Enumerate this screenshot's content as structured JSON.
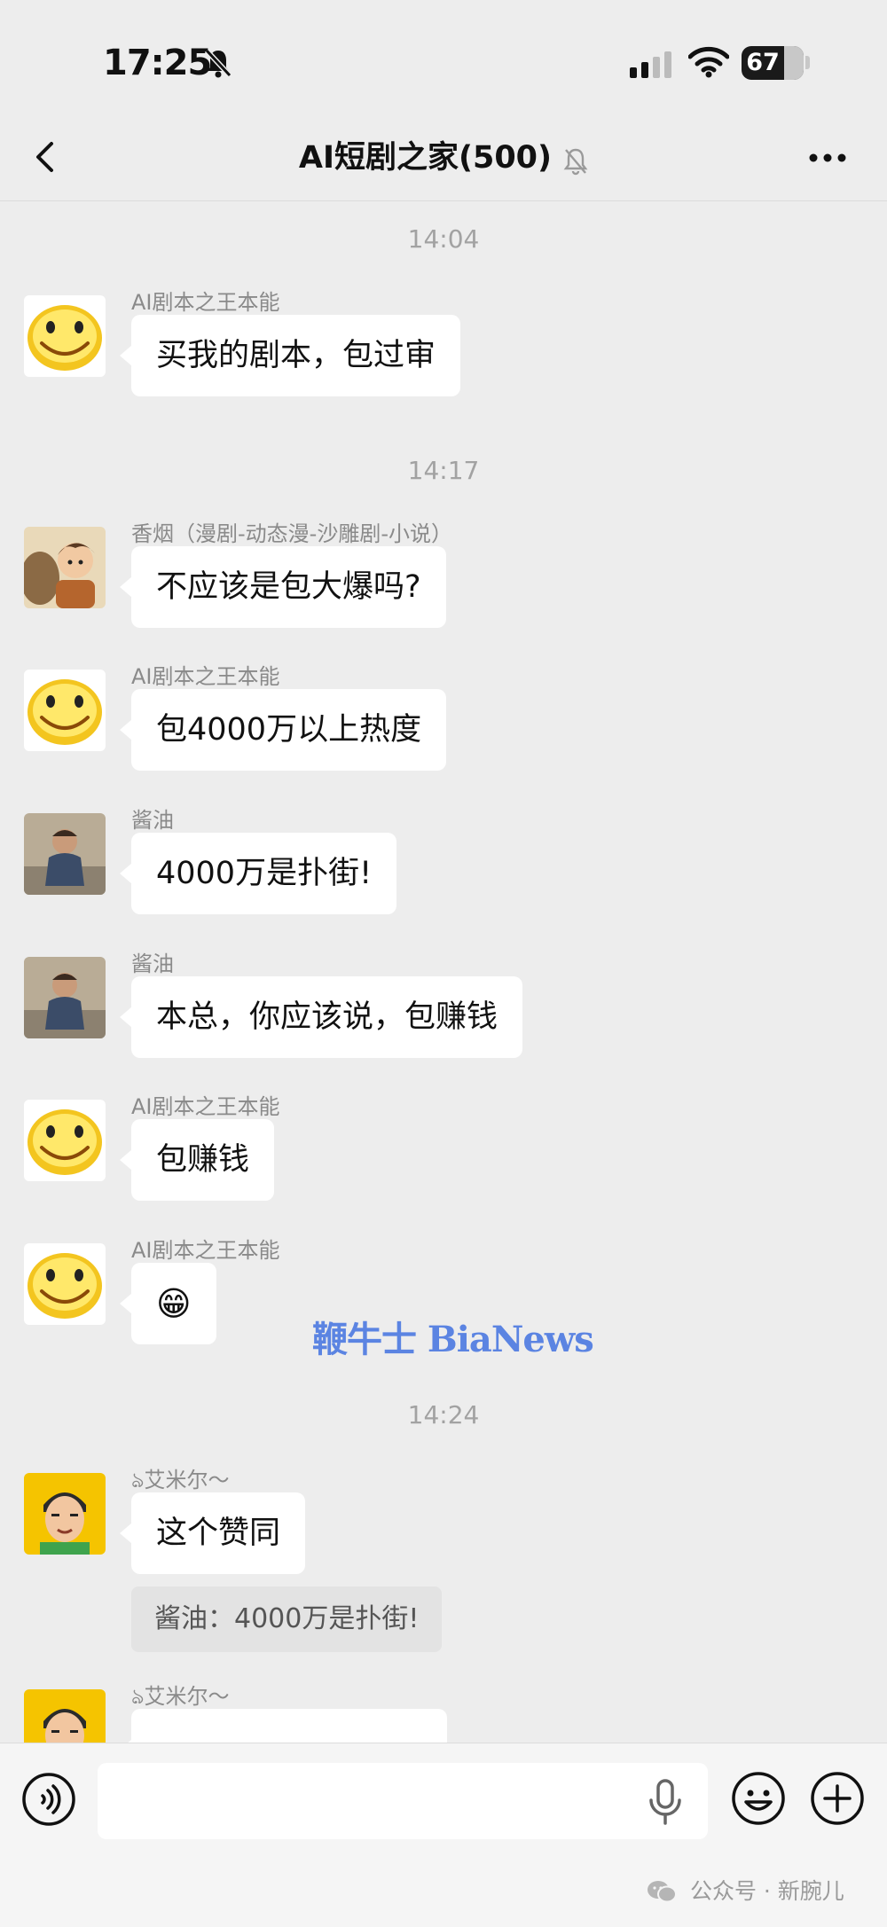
{
  "status_bar": {
    "time": "17:25",
    "battery": "67"
  },
  "header": {
    "title": "AI短剧之家(500)"
  },
  "messages": [
    {
      "time": "14:04"
    },
    {
      "sender": "AI剧本之王本能",
      "text": "买我的剧本，包过审"
    },
    {
      "time": "14:17"
    },
    {
      "sender": "香烟（漫剧-动态漫-沙雕剧-小说）",
      "text": "不应该是包大爆吗?"
    },
    {
      "sender": "AI剧本之王本能",
      "text": "包4000万以上热度"
    },
    {
      "sender": "酱油",
      "text": "4000万是扑街!"
    },
    {
      "sender": "酱油",
      "text": "本总，你应该说，包赚钱"
    },
    {
      "sender": "AI剧本之王本能",
      "text": "包赚钱"
    },
    {
      "sender": "AI剧本之王本能",
      "text": "😁"
    },
    {
      "time": "14:24"
    },
    {
      "sender": "ঌ艾米尔～",
      "text": "这个赞同",
      "quote": "酱油：4000万是扑街!"
    },
    {
      "sender": "ঌ艾米尔～"
    }
  ],
  "watermark": "鞭牛士 BiaNews",
  "footer": {
    "credit": "公众号 · 新腕儿"
  },
  "colors": {
    "background": "#ededed",
    "bubble": "#ffffff",
    "watermark": "#5b84e2"
  },
  "icons": [
    "bell-off-icon",
    "signal-icon",
    "wifi-icon",
    "battery-icon",
    "back-arrow-icon",
    "more-icon",
    "voice-icon",
    "mic-icon",
    "emoji-icon",
    "plus-icon",
    "wechat-logo-icon"
  ]
}
